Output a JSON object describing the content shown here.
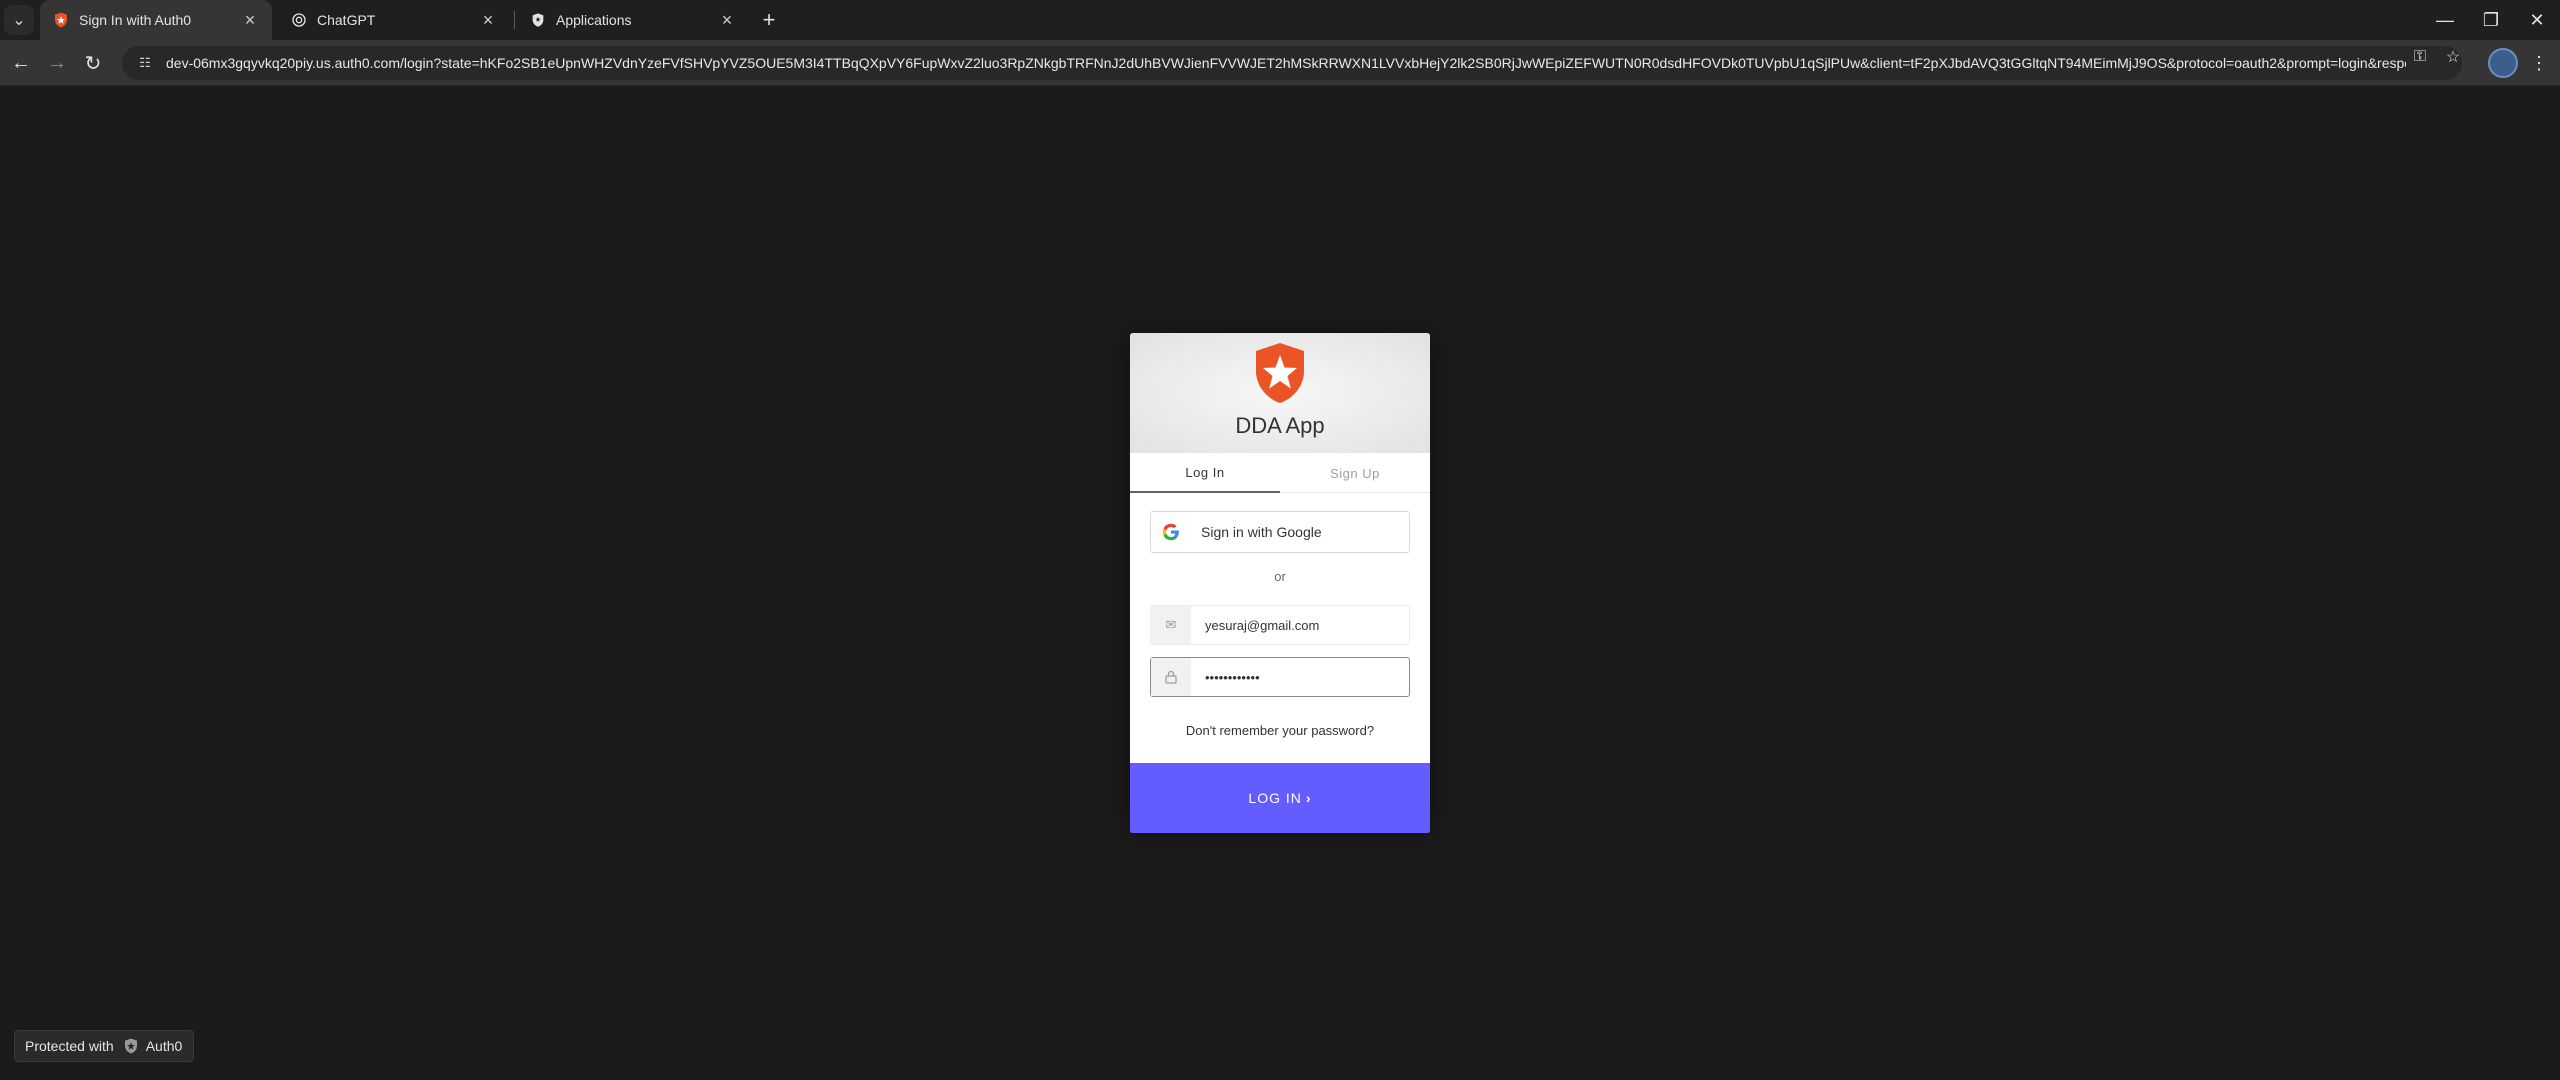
{
  "browser": {
    "tabs": [
      {
        "title": "Sign In with Auth0",
        "active": true,
        "favicon": "auth0-icon"
      },
      {
        "title": "ChatGPT",
        "active": false,
        "favicon": "openai-icon"
      },
      {
        "title": "Applications",
        "active": false,
        "favicon": "shield-icon"
      }
    ],
    "url": "dev-06mx3gqyvkq20piy.us.auth0.com/login?state=hKFo2SB1eUpnWHZVdnYzeFVfSHVpYVZ5OUE5M3I4TTBqQXpVY6FupWxvZ2luo3RpZNkgbTRFNnJ2dUhBVWJienFVVWJET2hMSkRRWXN1LVVxbHejY2lk2SB0RjJwWEpiZEFWUTN0R0dsdHFOVDk0TUVpbU1qSjlPUw&client=tF2pXJbdAVQ3tGGltqNT94MEimMjJ9OS&protocol=oauth2&prompt=login&response_type..."
  },
  "widget": {
    "app_name": "DDA App",
    "tabs": {
      "login": "Log In",
      "signup": "Sign Up"
    },
    "google_label": "Sign in with Google",
    "or_label": "or",
    "email_value": "yesuraj@gmail.com",
    "password_value": "••••••••••••",
    "forgot_label": "Don't remember your password?",
    "submit_label": "LOG IN",
    "submit_color": "#635dff",
    "brand_color": "#eb5424"
  },
  "badge": {
    "text": "Protected with",
    "brand": "Auth0"
  }
}
